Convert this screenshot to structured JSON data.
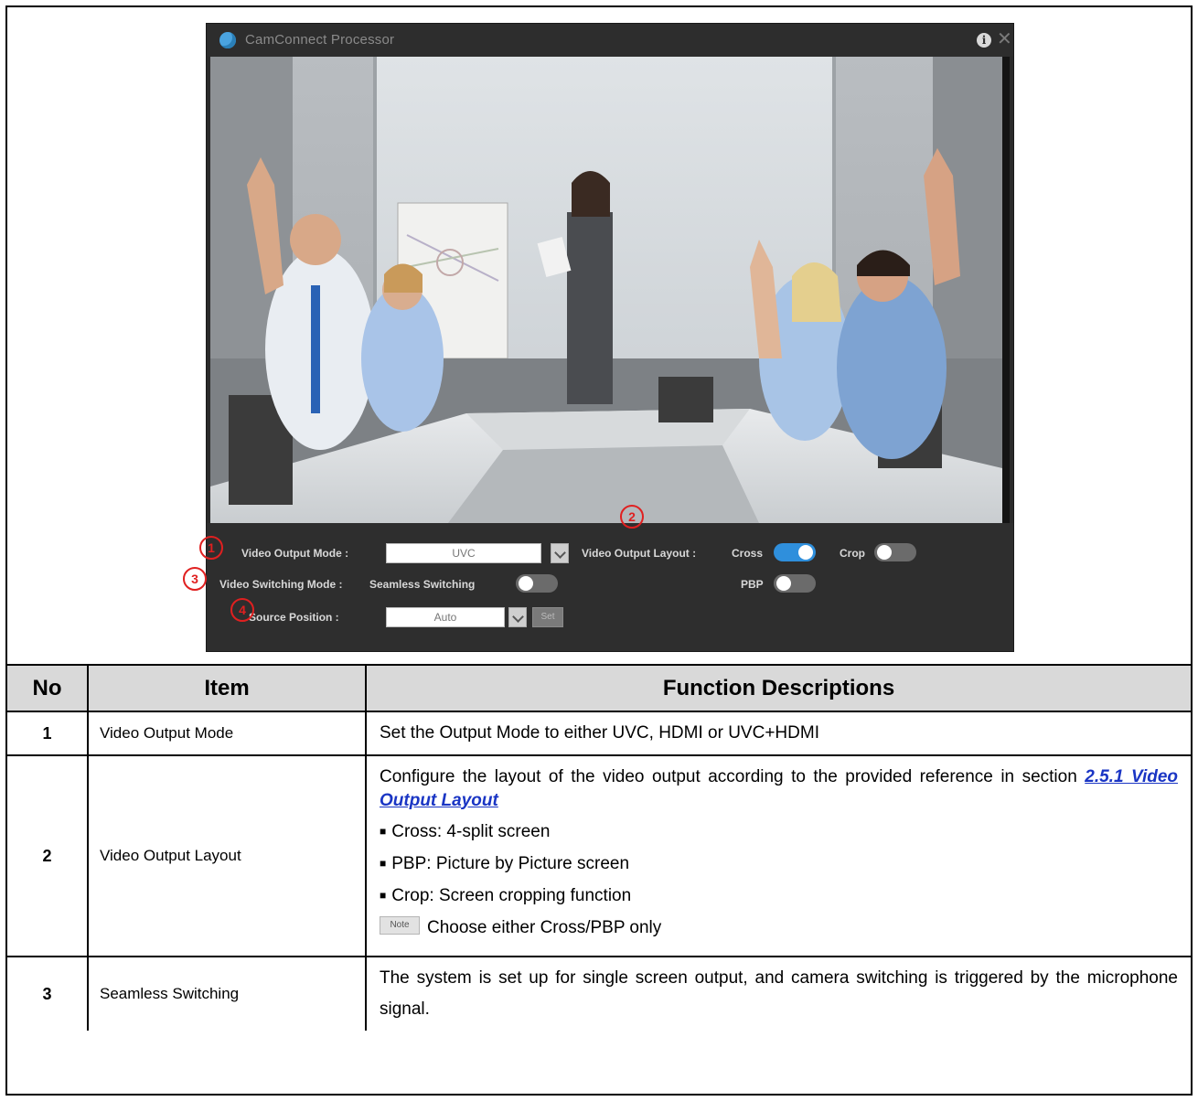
{
  "app": {
    "title": "CamConnect Processor",
    "info_glyph": "i",
    "close_glyph": "✕"
  },
  "controls": {
    "video_output_mode_label": "Video Output Mode :",
    "video_output_mode_value": "UVC",
    "video_output_layout_label": "Video Output Layout :",
    "cross_label": "Cross",
    "cross_on": true,
    "crop_label": "Crop",
    "crop_on": false,
    "pbp_label": "PBP",
    "pbp_on": false,
    "video_switching_mode_label": "Video Switching Mode :",
    "seamless_switching_label": "Seamless Switching",
    "seamless_on": false,
    "source_position_label": "Source Position :",
    "source_position_value": "Auto",
    "set_button_label": "Set"
  },
  "callouts": [
    "1",
    "2",
    "3",
    "4"
  ],
  "table": {
    "headers": [
      "No",
      "Item",
      "Function Descriptions"
    ],
    "rows": [
      {
        "no": "1",
        "item": "Video Output Mode",
        "description": "Set the Output Mode to either UVC, HDMI or UVC+HDMI"
      },
      {
        "no": "2",
        "item": "Video Output Layout",
        "description_intro": "Configure the layout of the video output according to the provided reference in section",
        "link_text": "2.5.1 Video Output Layout",
        "bullets": [
          "Cross: 4-split screen",
          "PBP: Picture by Picture screen",
          "Crop: Screen cropping function"
        ],
        "note_label": "Note",
        "note_text": "Choose either Cross/PBP only"
      },
      {
        "no": "3",
        "item": "Seamless Switching",
        "description": "The system is set up for single screen output, and camera switching is triggered by the microphone signal."
      }
    ]
  },
  "colors": {
    "callout": "#e02020",
    "toggle_on": "#2f8fdc",
    "link": "#1a35c4",
    "header_bg": "#d9d9d9"
  }
}
